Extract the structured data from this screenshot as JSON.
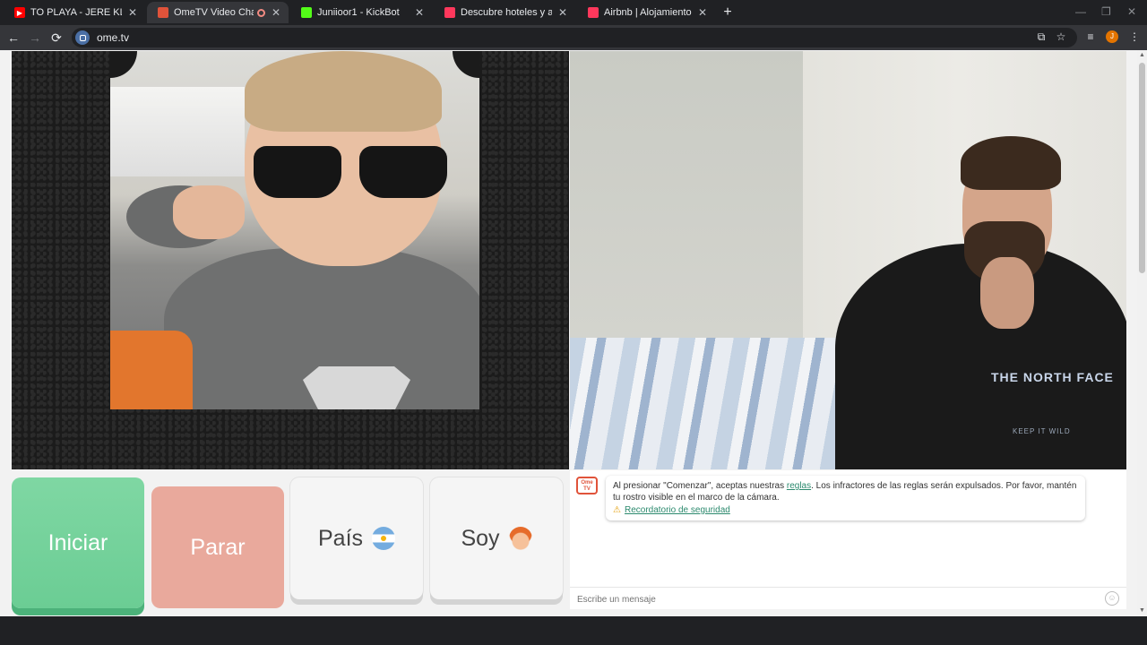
{
  "browser": {
    "tabs": [
      {
        "title": "TO PLAYA - JERE KLEIN Ft. JAIRO",
        "favicon_color": "#ff0000",
        "active": false
      },
      {
        "title": "OmeTV Video Chat — Ome",
        "favicon_color": "#e0533a",
        "active": true
      },
      {
        "title": "Juniioor1 - KickBot",
        "favicon_color": "#53fc18",
        "active": false
      },
      {
        "title": "Descubre hoteles y alojamientos",
        "favicon_color": "#ff385c",
        "active": false
      },
      {
        "title": "Airbnb | Alojamientos vacacionales",
        "favicon_color": "#ff385c",
        "active": false
      }
    ],
    "new_tab": "+",
    "url": "ome.tv",
    "profile_initial": "J",
    "nav": {
      "back": "←",
      "forward": "→",
      "reload": "⟳"
    },
    "icons": {
      "cast": "⧉",
      "bookmark": "☆",
      "menu": "⋮",
      "media": "≡",
      "minimize": "—",
      "restore": "❐",
      "close": "✕"
    }
  },
  "controls": {
    "start_label": "Iniciar",
    "stop_label": "Parar",
    "country_label": "País",
    "soy_label": "Soy"
  },
  "chat": {
    "logo": "Ome TV",
    "notice_before": "Al presionar \"Comenzar\", aceptas nuestras ",
    "rules_link": "reglas",
    "notice_after": ". Los infractores de las reglas serán expulsados. Por favor, mantén tu rostro visible en el marco de la cámara.",
    "safety_link": "Recordatorio de seguridad",
    "input_placeholder": "Escribe un mensaje"
  },
  "remote_video": {
    "shirt_text": "THE NORTH FACE",
    "shirt_subtext": "KEEP IT WILD"
  },
  "colors": {
    "start": "#6bcd94",
    "stop": "#e9a99c",
    "link": "#2c8a6e",
    "brand": "#e0533a"
  }
}
